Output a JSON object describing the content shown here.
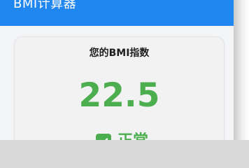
{
  "appbar": {
    "title": "BMI计算器",
    "color": "#1f87ef"
  },
  "result_card": {
    "title": "您的BMI指数",
    "bmi_value": "22.5",
    "status_label": "正常",
    "status_icon": "check-icon",
    "status_color": "#4cae4f"
  }
}
